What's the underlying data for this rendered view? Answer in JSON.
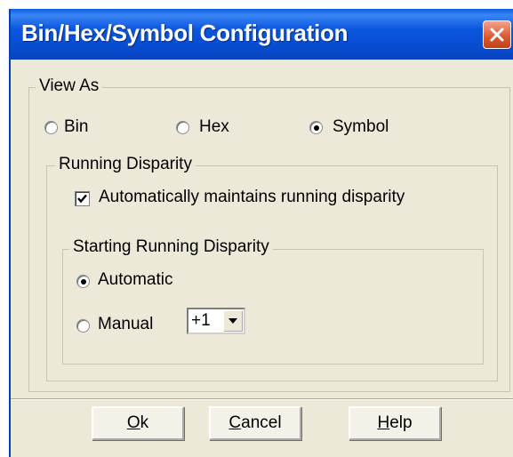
{
  "window": {
    "title": "Bin/Hex/Symbol Configuration"
  },
  "view_as": {
    "legend": "View As",
    "options": [
      {
        "label": "Bin",
        "checked": false
      },
      {
        "label": "Hex",
        "checked": false
      },
      {
        "label": "Symbol",
        "checked": true
      }
    ]
  },
  "running_disparity": {
    "legend": "Running Disparity",
    "auto_maintain": {
      "label": "Automatically maintains running disparity",
      "checked": true
    },
    "starting": {
      "legend": "Starting Running Disparity",
      "automatic_label": "Automatic",
      "manual_label": "Manual",
      "automatic_checked": true,
      "manual_value": "+1"
    }
  },
  "buttons": {
    "ok": {
      "mnemonic": "O",
      "rest": "k"
    },
    "cancel": {
      "mnemonic": "C",
      "rest": "ancel"
    },
    "help": {
      "mnemonic": "H",
      "rest": "elp"
    }
  }
}
